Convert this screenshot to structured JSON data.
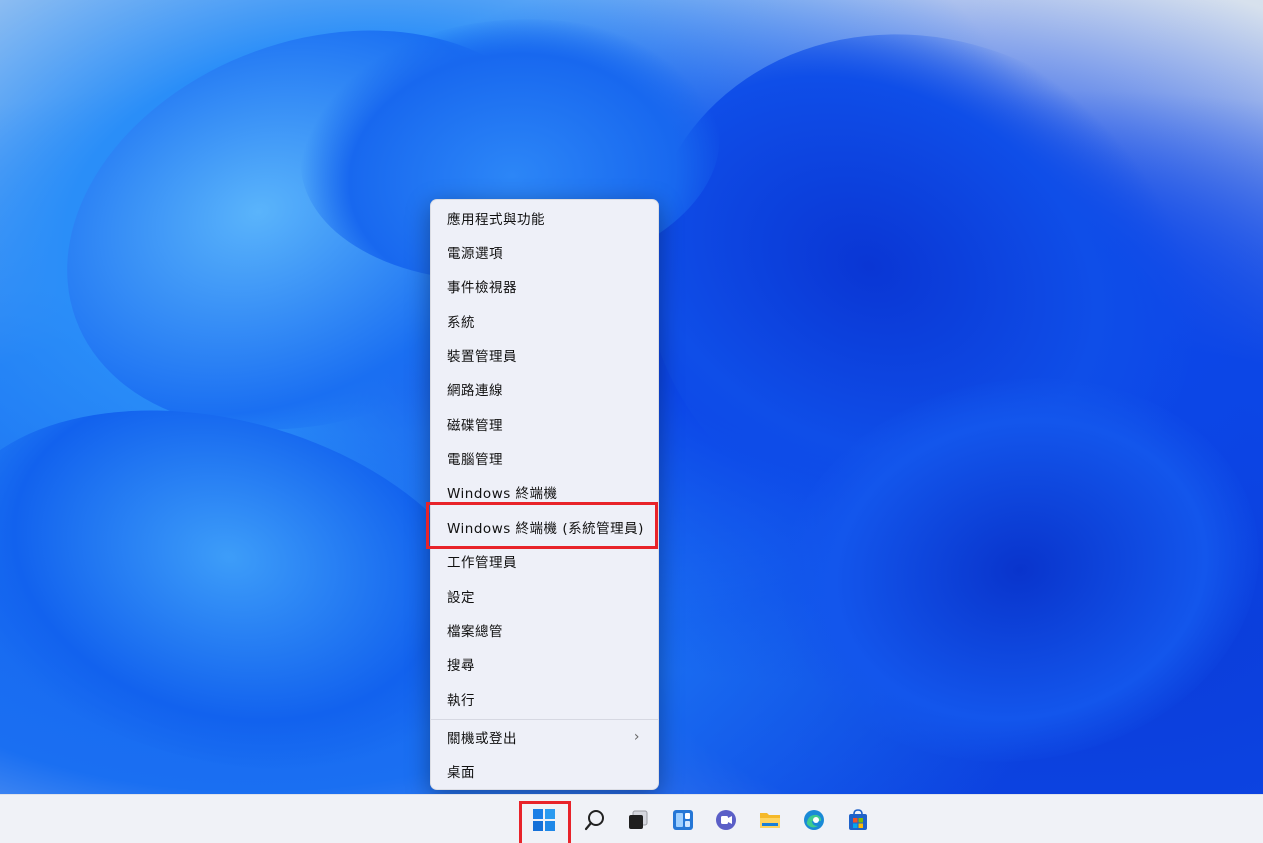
{
  "context_menu": {
    "items": [
      {
        "label": "應用程式與功能"
      },
      {
        "label": "電源選項"
      },
      {
        "label": "事件檢視器"
      },
      {
        "label": "系統"
      },
      {
        "label": "裝置管理員"
      },
      {
        "label": "網路連線"
      },
      {
        "label": "磁碟管理"
      },
      {
        "label": "電腦管理"
      },
      {
        "label": "Windows 終端機"
      },
      {
        "label": "Windows 終端機 (系統管理員)"
      },
      {
        "label": "工作管理員"
      },
      {
        "label": "設定"
      },
      {
        "label": "檔案總管"
      },
      {
        "label": "搜尋"
      },
      {
        "label": "執行"
      },
      {
        "label": "關機或登出",
        "submenu": true
      },
      {
        "label": "桌面"
      }
    ],
    "chevron": "›"
  },
  "taskbar": {
    "icons": [
      "windows-start-icon",
      "search-icon",
      "task-view-icon",
      "widgets-icon",
      "chat-icon",
      "file-explorer-icon",
      "edge-icon",
      "store-icon"
    ]
  },
  "colors": {
    "highlight": "#e8232a",
    "wallpaper_blue": "#1565ef",
    "menu_bg": "#eef0f8"
  }
}
